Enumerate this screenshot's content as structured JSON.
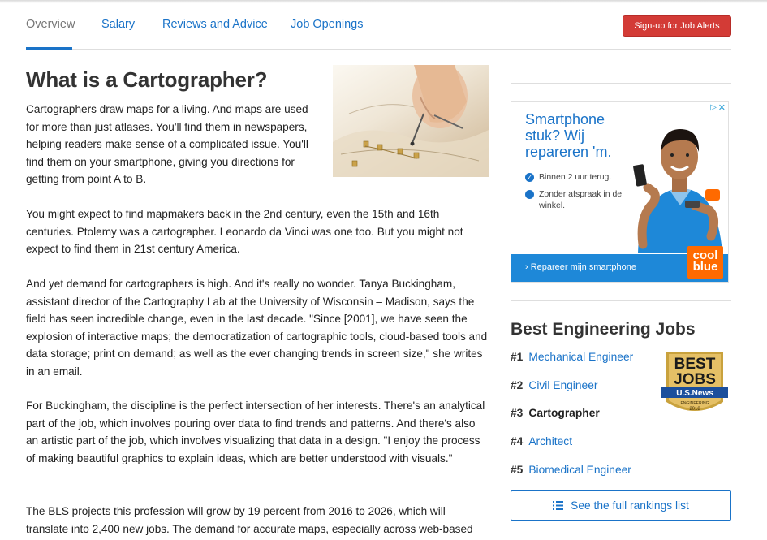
{
  "nav": {
    "tabs": [
      {
        "label": "Overview",
        "active": true
      },
      {
        "label": "Salary",
        "active": false
      },
      {
        "label": "Reviews and Advice",
        "active": false
      },
      {
        "label": "Job Openings",
        "active": false
      }
    ],
    "alert_button": "Sign-up for Job Alerts"
  },
  "article": {
    "title": "What is a Cartographer?",
    "paragraphs": [
      "Cartographers draw maps for a living. And maps are used for more than just atlases. You'll find them in newspapers, helping readers make sense of a complicated issue. You'll find them on your smartphone, giving you directions for getting from point A to B.",
      "You might expect to find mapmakers back in the 2nd century, even the 15th and 16th centuries. Ptolemy was a cartographer. Leonardo da Vinci was one too. But you might not expect to find them in 21st century America.",
      "And yet demand for cartographers is high. And it's really no wonder. Tanya Buckingham, assistant director of the Cartography Lab at the University of Wisconsin – Madison, says the field has seen incredible change, even in the last decade. \"Since [2001], we have seen the explosion of interactive maps; the democratization of cartographic tools, cloud-based tools and data storage; print on demand; as well as the ever changing trends in screen size,\" she writes in an email.",
      "For Buckingham, the discipline is the perfect intersection of her interests. There's an analytical part of the job, which involves pouring over data to find trends and patterns. And there's also an artistic part of the job, which involves visualizing that data in a design. \"I enjoy the process of making beautiful graphics to explain ideas, which are better understood with visuals.\"",
      "The BLS projects this profession will grow by 19 percent from 2016 to 2026, which will translate into 2,400 new jobs. The demand for accurate maps, especially across web-based"
    ]
  },
  "ad": {
    "headline": [
      "Smartphone",
      "stuk? Wij",
      "repareren 'm."
    ],
    "bullets": [
      "Binnen 2 uur terug.",
      "Zonder afspraak in de winkel."
    ],
    "bar_text": "› Repareer mijn smartphone",
    "logo": [
      "cool",
      "blue"
    ],
    "adchoices_icon": "adchoices-play-icon",
    "close_icon": "close-icon",
    "accent": "#1e88d8",
    "logo_color": "#ff6a00"
  },
  "sidebar": {
    "jobs_title": "Best Engineering Jobs",
    "rankings": [
      {
        "num": "#1",
        "label": "Mechanical Engineer",
        "link": true
      },
      {
        "num": "#2",
        "label": "Civil Engineer",
        "link": true
      },
      {
        "num": "#3",
        "label": "Cartographer",
        "link": false
      },
      {
        "num": "#4",
        "label": "Architect",
        "link": true
      },
      {
        "num": "#5",
        "label": "Biomedical Engineer",
        "link": true
      }
    ],
    "badge": {
      "line1": "BEST",
      "line2": "JOBS",
      "brand": "U.S.News",
      "category": "ENGINEERING",
      "year": "2018"
    },
    "full_button": "See the full rankings list"
  },
  "colors": {
    "link": "#1a73c8",
    "alert": "#d33b36",
    "text": "#222222"
  }
}
